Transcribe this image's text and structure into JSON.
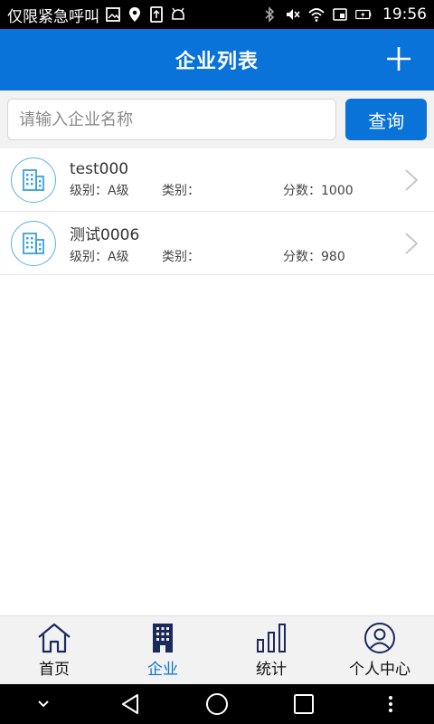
{
  "status_bar": {
    "carrier_text": "仅限紧急呼叫",
    "time": "19:56"
  },
  "header": {
    "title": "企业列表"
  },
  "search": {
    "placeholder": "请输入企业名称",
    "value": "",
    "button_label": "查询"
  },
  "companies": [
    {
      "name": "test000",
      "level": "级别：A级",
      "category": "类别：",
      "score": "分数：1000"
    },
    {
      "name": "测试0006",
      "level": "级别：A级",
      "category": "类别：",
      "score": "分数：980"
    }
  ],
  "bottom_nav": {
    "items": [
      {
        "label": "首页",
        "icon": "home-icon",
        "active": false
      },
      {
        "label": "企业",
        "icon": "building-icon",
        "active": true
      },
      {
        "label": "统计",
        "icon": "bar-chart-icon",
        "active": false
      },
      {
        "label": "个人中心",
        "icon": "user-icon",
        "active": false
      }
    ]
  },
  "colors": {
    "primary": "#0a73d9",
    "avatar_border": "#5ab3dd"
  }
}
